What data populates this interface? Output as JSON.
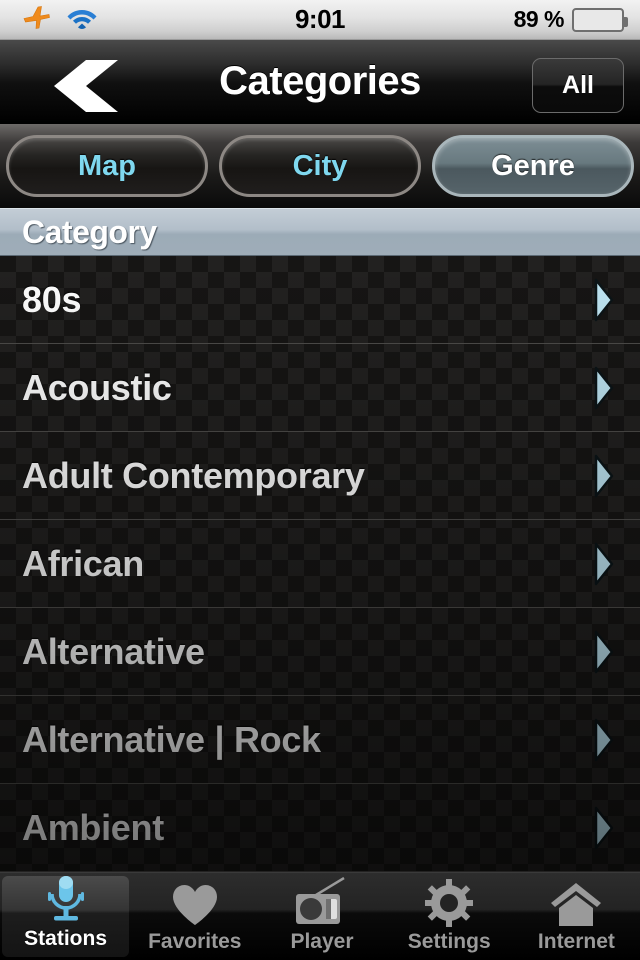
{
  "status_bar": {
    "airplane_icon": "airplane-icon",
    "wifi_icon": "wifi-icon",
    "time": "9:01",
    "battery_percent": "89 %",
    "battery_icon": "battery-icon",
    "battery_level": 89
  },
  "nav_bar": {
    "back_icon": "back-chevron-icon",
    "title": "Categories",
    "right_button": "All"
  },
  "segmented_control": {
    "options": [
      {
        "label": "Map",
        "selected": false
      },
      {
        "label": "City",
        "selected": false
      },
      {
        "label": "Genre",
        "selected": true
      }
    ]
  },
  "section_header": {
    "title": "Category"
  },
  "list": {
    "rows": [
      {
        "label": "80s",
        "disclosure_icon": "chevron-right-icon"
      },
      {
        "label": "Acoustic",
        "disclosure_icon": "chevron-right-icon"
      },
      {
        "label": "Adult Contemporary",
        "disclosure_icon": "chevron-right-icon"
      },
      {
        "label": "African",
        "disclosure_icon": "chevron-right-icon"
      },
      {
        "label": "Alternative",
        "disclosure_icon": "chevron-right-icon"
      },
      {
        "label": "Alternative | Rock",
        "disclosure_icon": "chevron-right-icon"
      },
      {
        "label": "Ambient",
        "disclosure_icon": "chevron-right-icon"
      }
    ]
  },
  "tab_bar": {
    "tabs": [
      {
        "label": "Stations",
        "icon": "microphone-icon",
        "selected": true
      },
      {
        "label": "Favorites",
        "icon": "heart-icon",
        "selected": false
      },
      {
        "label": "Player",
        "icon": "radio-icon",
        "selected": false
      },
      {
        "label": "Settings",
        "icon": "gear-icon",
        "selected": false
      },
      {
        "label": "Internet",
        "icon": "house-icon",
        "selected": false
      }
    ]
  },
  "colors": {
    "accent_cyan": "#7fd8ef",
    "disclosure_blue": "#b9e4f2",
    "selected_tab_blue": "#4aa8d8",
    "battery_green": "#55bd1c",
    "airplane_orange": "#f08a1e",
    "wifi_blue": "#1b72c6",
    "header_gray": "#b2bec9"
  }
}
